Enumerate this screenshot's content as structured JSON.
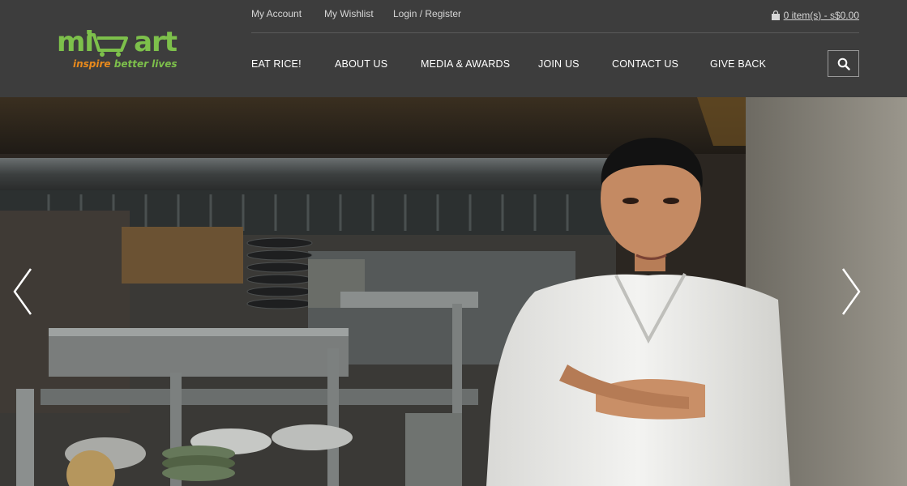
{
  "brand": {
    "logo_text": "mimart",
    "tagline_lead": "inspire",
    "tagline_rest": "better lives",
    "primary_color": "#7dc04b",
    "accent_color": "#e98a1c"
  },
  "top_links": [
    "My Account",
    "My Wishlist",
    "Login / Register"
  ],
  "cart": {
    "icon": "shopping-bag-icon",
    "label": "0 item(s) - s$0.00"
  },
  "nav": [
    "EAT RICE!",
    "ABOUT US",
    "MEDIA & AWARDS",
    "JOIN US",
    "CONTACT US",
    "GIVE BACK"
  ],
  "search": {
    "icon": "search-icon"
  },
  "hero": {
    "scene": "chef-in-commercial-kitchen-photo",
    "prev_icon": "chevron-left-icon",
    "next_icon": "chevron-right-icon"
  }
}
